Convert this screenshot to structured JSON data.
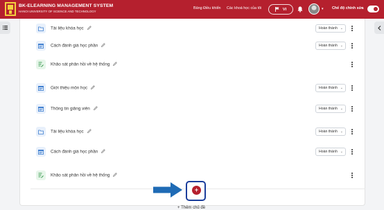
{
  "header": {
    "brand_title": "BK-ELEARNING MANAGEMENT SYSTEM",
    "brand_subtitle": "HANOI UNIVERSITY OF SCIENCE AND TECHNOLOGY",
    "nav_dashboard": "Bảng Điều khiển",
    "nav_my_courses": "Các khoá học của tôi",
    "language": "VI",
    "edit_mode_label": "Chế độ chỉnh sửa",
    "edit_mode_on": true
  },
  "activities": [
    {
      "name": "Tài liệu khóa học",
      "icon": "folder-icon",
      "type": "blue",
      "completion": "Hoàn thành"
    },
    {
      "name": "Cách đánh giá học phần",
      "icon": "page-icon",
      "type": "blue",
      "completion": "Hoàn thành"
    },
    {
      "name": "Khảo sát phản hồi về hệ thống",
      "icon": "feedback-icon",
      "type": "green",
      "completion": ""
    },
    {
      "name": "Giới thiệu môn học",
      "icon": "page-icon",
      "type": "blue",
      "completion": "Hoàn thành"
    },
    {
      "name": "Thông tin giảng viên",
      "icon": "page-icon",
      "type": "blue",
      "completion": "Hoàn thành"
    },
    {
      "name": "Tài liệu khóa học",
      "icon": "folder-icon",
      "type": "blue",
      "completion": "Hoàn thành"
    },
    {
      "name": "Cách đánh giá học phần",
      "icon": "page-icon",
      "type": "blue",
      "completion": "Hoàn thành"
    },
    {
      "name": "Khảo sát phản hồi về hệ thống",
      "icon": "feedback-icon",
      "type": "green",
      "completion": ""
    }
  ],
  "add_topic": {
    "symbol": "+",
    "label": "+ Thêm chủ đề"
  },
  "colors": {
    "brand_red": "#b5202e",
    "highlight_blue": "#1a3d9b",
    "arrow_blue": "#1f6bb5"
  }
}
